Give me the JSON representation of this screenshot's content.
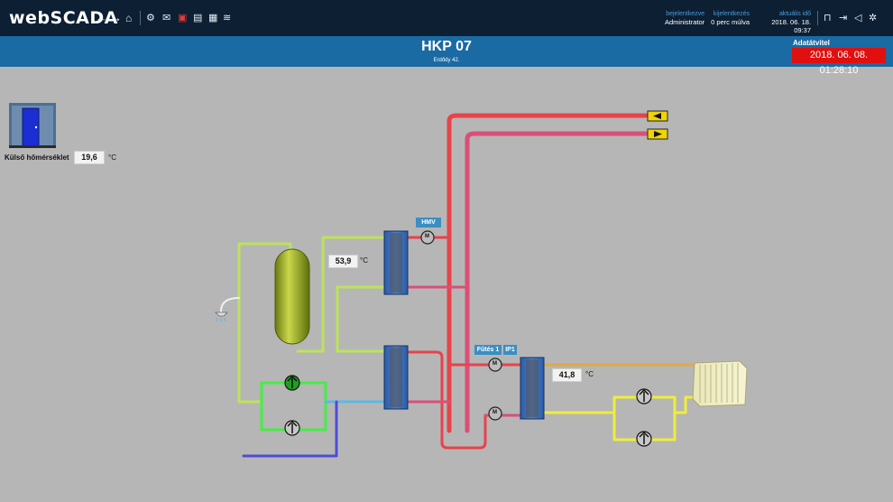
{
  "app": {
    "logo": "webSCADA"
  },
  "toolbar": {
    "nav_icons": [
      "back-arrow-icon",
      "forward-arrow-icon",
      "home-icon"
    ],
    "tool_icons": [
      "cpu-chip-icon",
      "chat-icon",
      "alarm-icon",
      "chart-icon",
      "calendar-icon",
      "wifi-icon"
    ],
    "right_icons": [
      "lock-icon",
      "logout-icon",
      "speaker-icon",
      "gear-icon"
    ]
  },
  "status": {
    "login_label": "bejelentkezve",
    "login_value": "Administrator",
    "logout_label": "kijelentkezés",
    "logout_value": "0 perc múlva",
    "time_label": "aktuális idő",
    "time_value": "2018. 06. 18. 09:37"
  },
  "header": {
    "title": "HKP 07",
    "subtitle": "Erdődy 42.",
    "transfer_label": "Adatátvitel",
    "transfer_value": "2018. 06. 08. 01:28:10"
  },
  "process": {
    "outdoor_label": "Külső hőmérséklet",
    "outdoor_value": "19,6",
    "outdoor_unit": "°C",
    "dhw_temp": "53,9",
    "dhw_unit": "°C",
    "heating_temp": "41,8",
    "heating_unit": "°C",
    "tag_hmv": "HMV",
    "tag_futes": "Fűtés 1",
    "tag_ip": "IP1",
    "valve_label": "M"
  },
  "colors": {
    "topbar": "#0c1f33",
    "titlebar": "#1a6aa3",
    "alarm": "#e01010",
    "supply": "#e8434b",
    "return": "#d94f7a",
    "dhw_green": "#bde35a",
    "cold_water": "#5db8e6",
    "pump_green": "#44ee44",
    "yellow_loop": "#eeee3a",
    "background": "#b6b6b6"
  }
}
